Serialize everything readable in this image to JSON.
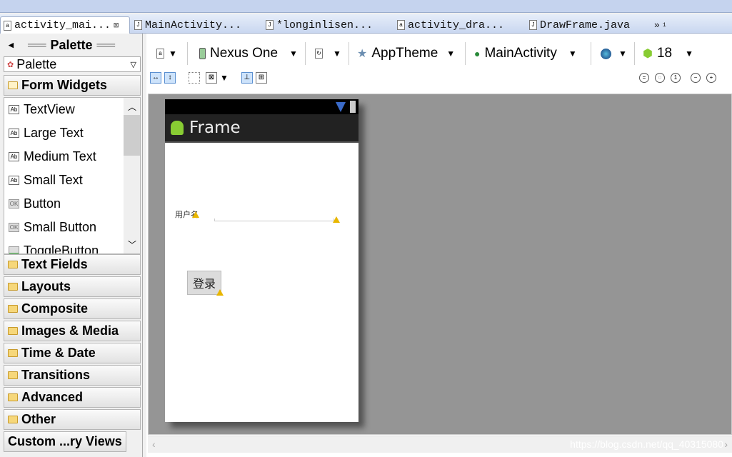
{
  "tabs": [
    {
      "label": "activity_mai...",
      "icon": "xml-file-icon",
      "active": true
    },
    {
      "label": "MainActivity...",
      "icon": "java-file-icon"
    },
    {
      "label": "*longinlisen...",
      "icon": "java-file-icon"
    },
    {
      "label": "activity_dra...",
      "icon": "xml-file-icon"
    },
    {
      "label": "DrawFrame.java",
      "icon": "java-file-icon"
    }
  ],
  "tabs_overflow": "»",
  "tabs_overflow_count": "1",
  "palette": {
    "title": "Palette",
    "dropdown": "Palette",
    "open_category": "Form Widgets",
    "widgets": [
      {
        "label": "TextView",
        "icon": "Ab"
      },
      {
        "label": "Large Text",
        "icon": "Ab"
      },
      {
        "label": "Medium Text",
        "icon": "Ab"
      },
      {
        "label": "Small Text",
        "icon": "Ab"
      },
      {
        "label": "Button",
        "icon": "OK"
      },
      {
        "label": "Small Button",
        "icon": "OK"
      },
      {
        "label": "ToggleButton",
        "icon": "toggle"
      }
    ],
    "categories": [
      "Text Fields",
      "Layouts",
      "Composite",
      "Images & Media",
      "Time & Date",
      "Transitions",
      "Advanced",
      "Other"
    ],
    "custom": "Custom ...ry Views"
  },
  "toolbar": {
    "device": "Nexus One",
    "theme": "AppTheme",
    "activity": "MainActivity",
    "api": "18"
  },
  "device": {
    "app_title": "Frame",
    "label": "用户名",
    "button": "登录"
  },
  "watermark": "https://blog.csdn.net/qq_40315080",
  "colors": {
    "canvas": "#959595",
    "action_bar": "#222222",
    "warning": "#e8b600"
  }
}
